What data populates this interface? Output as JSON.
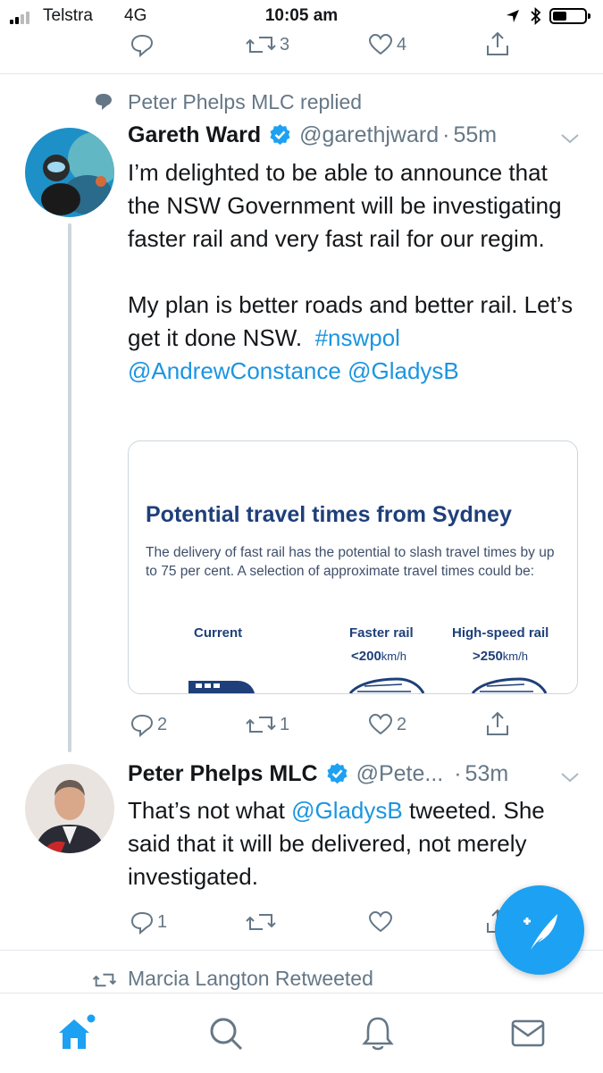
{
  "status_bar": {
    "carrier": "Telstra",
    "network": "4G",
    "time": "10:05 am"
  },
  "prev_tweet_actions": {
    "reply_count": "",
    "retweet_count": "3",
    "like_count": "4"
  },
  "thread": {
    "context_label": "Peter Phelps MLC replied",
    "tweet1": {
      "display_name": "Gareth Ward",
      "handle": "@garethjward",
      "separator": "·",
      "time": "55m",
      "para1": "I’m delighted to be able to announce that the NSW Government will be investigating faster rail and very fast rail for our regim.",
      "para2_text": "My plan is better roads and better rail. Let’s get it done NSW.",
      "hashtag": "#nswpol",
      "mention1": "@AndrewConstance",
      "mention2": "@GladysB",
      "card": {
        "title": "Potential travel times from Sydney",
        "body": "The delivery of fast rail has the potential to slash travel times by up to 75 per cent. A selection of approximate travel times could be:",
        "col_current": "Current",
        "col_faster": "Faster rail",
        "col_high": "High-speed rail",
        "faster_speed": "<200",
        "high_speed": ">250",
        "speed_unit": "km/h"
      },
      "reply_count": "2",
      "retweet_count": "1",
      "like_count": "2"
    },
    "tweet2": {
      "display_name": "Peter Phelps MLC",
      "handle": "@Pete...",
      "separator": "·",
      "time": "53m",
      "text_part1": "That’s not what",
      "mention": "@GladysB",
      "text_part2": "tweeted. She said that it will be delivered, not merely investigated.",
      "reply_count": "1",
      "retweet_count": "",
      "like_count": ""
    }
  },
  "next_context_label": "Marcia Langton Retweeted",
  "colors": {
    "accent": "#1da1f2",
    "link": "#1b95e0",
    "verified": "#1da1f2",
    "secondary_text": "#657786",
    "card_navy": "#1e3f7a"
  },
  "tabs": [
    "home-icon",
    "search-icon",
    "notifications-icon",
    "messages-icon"
  ]
}
